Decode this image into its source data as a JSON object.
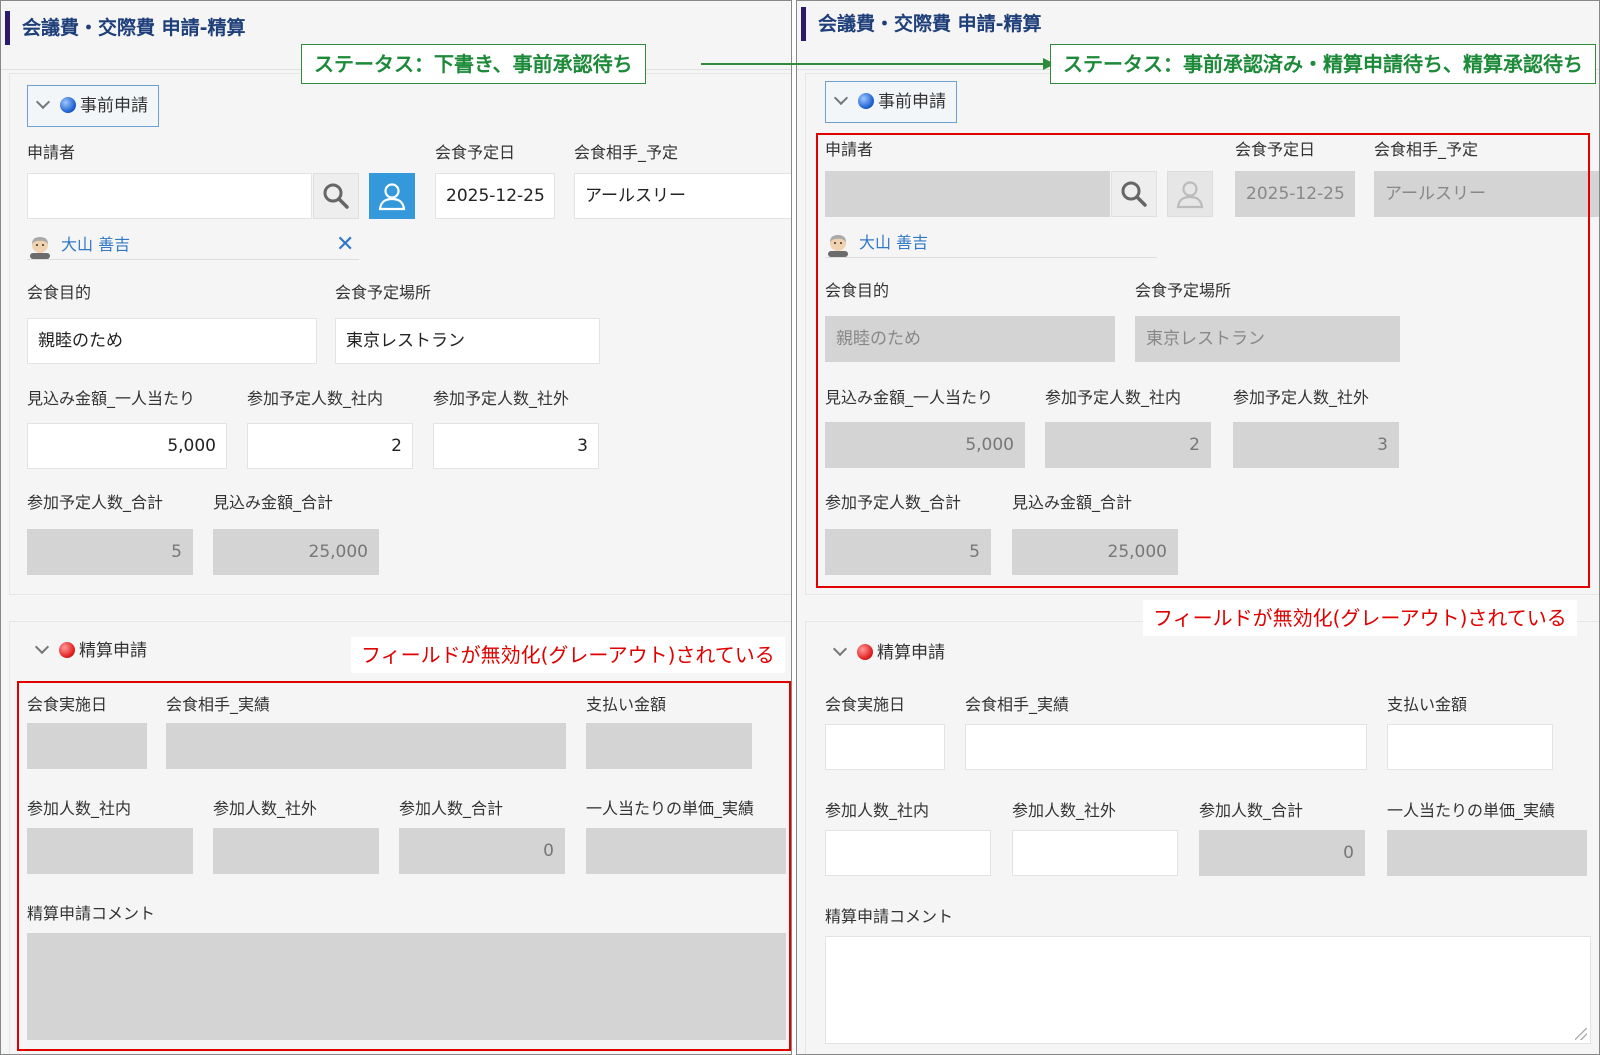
{
  "status_left": "ステータス：下書き、事前承認待ち",
  "status_right": "ステータス：事前承認済み・精算申請待ち、精算承認待ち",
  "note_text": "フィールドが無効化(グレーアウト)されている",
  "colors": {
    "accent_border": "#2b1a6b",
    "title": "#1f3f7a",
    "status": "#1d8a3a",
    "highlight": "#e00000",
    "user_button": "#3498db",
    "disabled_field": "#d4d4d4"
  },
  "form": {
    "title": "会議費・交際費 申請-精算",
    "section1": {
      "header": "事前申請",
      "applicant_label": "申請者",
      "applicant_value": "",
      "applicant_name": "大山 善吉",
      "meal_date_label": "会食予定日",
      "meal_date": "2025-12-25",
      "partner_label": "会食相手_予定",
      "partner": "アールスリー",
      "purpose_label": "会食目的",
      "purpose": "親睦のため",
      "place_label": "会食予定場所",
      "place": "東京レストラン",
      "est_per_person_label": "見込み金額_一人当たり",
      "est_per_person": "5,000",
      "internal_label": "参加予定人数_社内",
      "internal": "2",
      "external_label": "参加予定人数_社外",
      "external": "3",
      "total_people_label": "参加予定人数_合計",
      "total_people": "5",
      "total_amount_label": "見込み金額_合計",
      "total_amount": "25,000"
    },
    "section2": {
      "header": "精算申請",
      "actual_date_label": "会食実施日",
      "actual_date": "",
      "actual_partner_label": "会食相手_実績",
      "actual_partner": "",
      "payment_label": "支払い金額",
      "payment": "",
      "internal_label": "参加人数_社内",
      "internal": "",
      "external_label": "参加人数_社外",
      "external": "",
      "total_label": "参加人数_合計",
      "total": "0",
      "unit_price_label": "一人当たりの単価_実績",
      "unit_price": "",
      "comment_label": "精算申請コメント",
      "comment": ""
    }
  }
}
